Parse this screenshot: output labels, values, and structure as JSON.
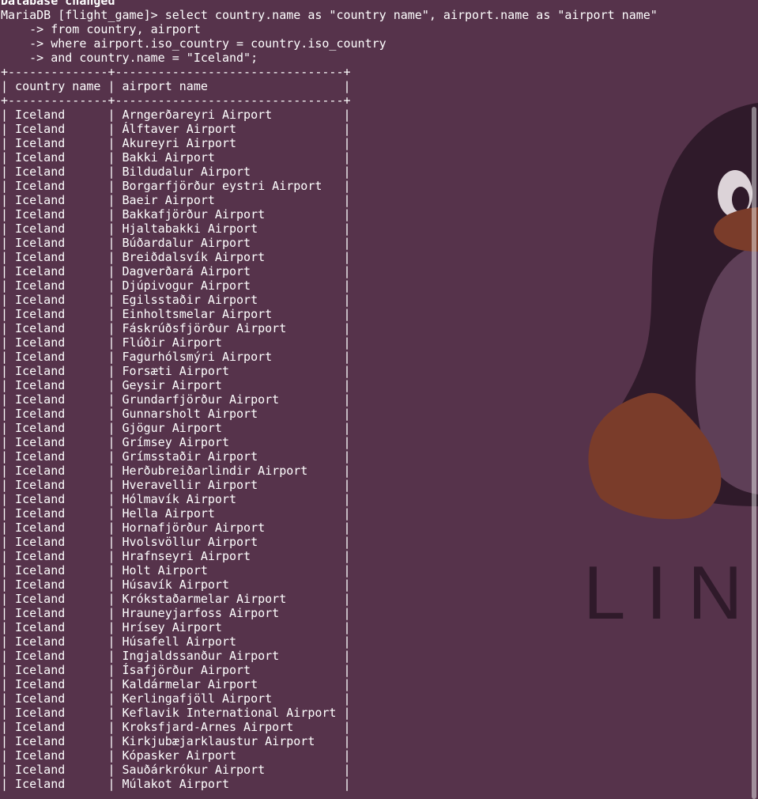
{
  "terminal": {
    "status_line": "Database changed",
    "prompt": "MariaDB [flight_game]>",
    "query_lines": [
      "select country.name as \"country name\", airport.name as \"airport name\"",
      "from country, airport",
      "where airport.iso_country = country.iso_country",
      "and country.name = \"Iceland\";"
    ],
    "continuation_prompt": "->"
  },
  "result_table": {
    "columns": [
      "country name",
      "airport name"
    ],
    "rows": [
      [
        "Iceland",
        "Arngerðareyri Airport"
      ],
      [
        "Iceland",
        "Álftaver Airport"
      ],
      [
        "Iceland",
        "Akureyri Airport"
      ],
      [
        "Iceland",
        "Bakki Airport"
      ],
      [
        "Iceland",
        "Bildudalur Airport"
      ],
      [
        "Iceland",
        "Borgarfjörður eystri Airport"
      ],
      [
        "Iceland",
        "Baeir Airport"
      ],
      [
        "Iceland",
        "Bakkafjörður Airport"
      ],
      [
        "Iceland",
        "Hjaltabakki Airport"
      ],
      [
        "Iceland",
        "Búðardalur Airport"
      ],
      [
        "Iceland",
        "Breiðdalsvík Airport"
      ],
      [
        "Iceland",
        "Dagverðará Airport"
      ],
      [
        "Iceland",
        "Djúpivogur Airport"
      ],
      [
        "Iceland",
        "Egilsstaðir Airport"
      ],
      [
        "Iceland",
        "Einholtsmelar Airport"
      ],
      [
        "Iceland",
        "Fáskrúðsfjörður Airport"
      ],
      [
        "Iceland",
        "Flúðir Airport"
      ],
      [
        "Iceland",
        "Fagurhólsmýri Airport"
      ],
      [
        "Iceland",
        "Forsæti Airport"
      ],
      [
        "Iceland",
        "Geysir Airport"
      ],
      [
        "Iceland",
        "Grundarfjörður Airport"
      ],
      [
        "Iceland",
        "Gunnarsholt Airport"
      ],
      [
        "Iceland",
        "Gjögur Airport"
      ],
      [
        "Iceland",
        "Grímsey Airport"
      ],
      [
        "Iceland",
        "Grímsstaðir Airport"
      ],
      [
        "Iceland",
        "Herðubreiðarlindir Airport"
      ],
      [
        "Iceland",
        "Hveravellir Airport"
      ],
      [
        "Iceland",
        "Hólmavík Airport"
      ],
      [
        "Iceland",
        "Hella Airport"
      ],
      [
        "Iceland",
        "Hornafjörður Airport"
      ],
      [
        "Iceland",
        "Hvolsvöllur Airport"
      ],
      [
        "Iceland",
        "Hrafnseyri Airport"
      ],
      [
        "Iceland",
        "Holt Airport"
      ],
      [
        "Iceland",
        "Húsavík Airport"
      ],
      [
        "Iceland",
        "Krókstaðarmelar Airport"
      ],
      [
        "Iceland",
        "Hrauneyjarfoss Airport"
      ],
      [
        "Iceland",
        "Hrísey Airport"
      ],
      [
        "Iceland",
        "Húsafell Airport"
      ],
      [
        "Iceland",
        "Ingjaldssanður Airport"
      ],
      [
        "Iceland",
        "Ísafjörður Airport"
      ],
      [
        "Iceland",
        "Kaldármelar Airport"
      ],
      [
        "Iceland",
        "Kerlingafjöll Airport"
      ],
      [
        "Iceland",
        "Keflavik International Airport"
      ],
      [
        "Iceland",
        "Kroksfjard-Arnes Airport"
      ],
      [
        "Iceland",
        "Kirkjubæjarklaustur Airport"
      ],
      [
        "Iceland",
        "Kópasker Airport"
      ],
      [
        "Iceland",
        "Sauðárkrókur Airport"
      ],
      [
        "Iceland",
        "Múlakot Airport"
      ]
    ]
  },
  "wallpaper": {
    "text": "LIN",
    "colors": {
      "background": "#56334b",
      "penguin_body": "#2f1a2a",
      "penguin_belly": "#5e3f57",
      "penguin_feet": "#7a3c2a",
      "wallpaper_text": "#2f1a2a",
      "terminal_text": "#ffffff"
    }
  }
}
